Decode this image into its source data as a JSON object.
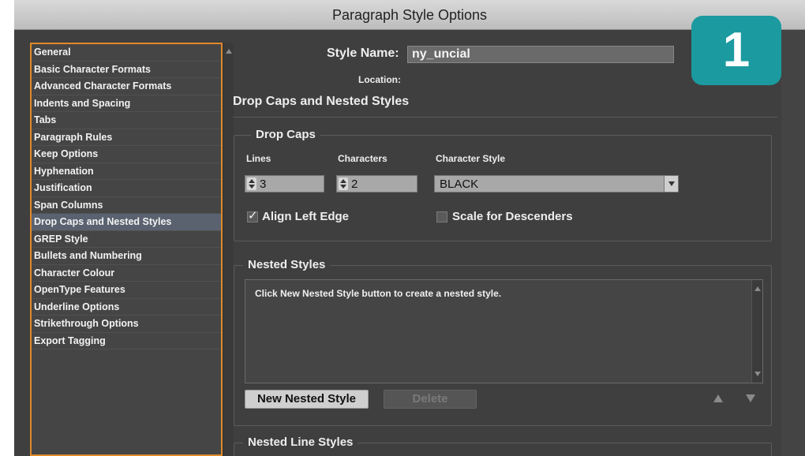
{
  "window": {
    "title": "Paragraph Style Options"
  },
  "sidebar": {
    "items": [
      {
        "label": "General",
        "selected": false
      },
      {
        "label": "Basic Character Formats",
        "selected": false
      },
      {
        "label": "Advanced Character Formats",
        "selected": false
      },
      {
        "label": "Indents and Spacing",
        "selected": false
      },
      {
        "label": "Tabs",
        "selected": false
      },
      {
        "label": "Paragraph Rules",
        "selected": false
      },
      {
        "label": "Keep Options",
        "selected": false
      },
      {
        "label": "Hyphenation",
        "selected": false
      },
      {
        "label": "Justification",
        "selected": false
      },
      {
        "label": "Span Columns",
        "selected": false
      },
      {
        "label": "Drop Caps and Nested Styles",
        "selected": true
      },
      {
        "label": "GREP Style",
        "selected": false
      },
      {
        "label": "Bullets and Numbering",
        "selected": false
      },
      {
        "label": "Character Colour",
        "selected": false
      },
      {
        "label": "OpenType Features",
        "selected": false
      },
      {
        "label": "Underline Options",
        "selected": false
      },
      {
        "label": "Strikethrough Options",
        "selected": false
      },
      {
        "label": "Export Tagging",
        "selected": false
      }
    ],
    "border_color": "#e08a2a"
  },
  "header": {
    "style_name_label": "Style Name:",
    "style_name_value": "ny_uncial",
    "location_label": "Location:"
  },
  "section": {
    "title": "Drop Caps and Nested Styles"
  },
  "drop_caps": {
    "title": "Drop Caps",
    "lines_label": "Lines",
    "lines_value": "3",
    "characters_label": "Characters",
    "characters_value": "2",
    "character_style_label": "Character Style",
    "character_style_value": "BLACK",
    "align_left_edge_label": "Align Left Edge",
    "align_left_edge_checked": true,
    "scale_descenders_label": "Scale for Descenders",
    "scale_descenders_checked": false
  },
  "nested_styles": {
    "title": "Nested Styles",
    "empty_message": "Click New Nested Style button to create a nested style.",
    "new_button": "New Nested Style",
    "delete_button": "Delete"
  },
  "nested_line_styles": {
    "title": "Nested Line Styles"
  },
  "badge": {
    "label": "1",
    "color": "#1b9aa0"
  },
  "icons": {
    "checkbox_check": "check-icon",
    "move_up": "triangle-up-icon",
    "move_down": "triangle-down-icon"
  }
}
